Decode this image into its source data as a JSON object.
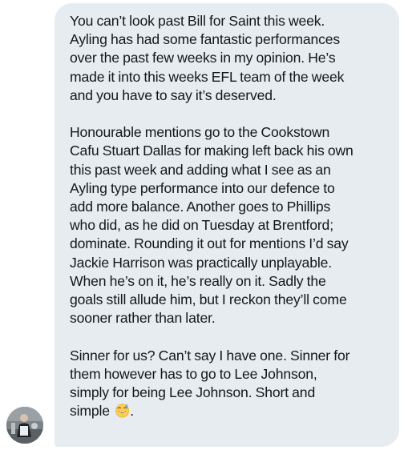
{
  "message": {
    "paragraphs": [
      {
        "lines": [
          "You can’t look past Bill for Saint this week.",
          "Ayling has had some fantastic performances",
          "over the past few weeks in my opinion. He’s",
          "made it into this weeks EFL team of the week",
          "and you have to say it’s deserved."
        ]
      },
      {
        "lines": [
          "Honourable mentions go to the Cookstown",
          "Cafu Stuart Dallas for making left back his own",
          "this past week and adding what I see as an",
          "Ayling type performance into our defence to",
          "add more balance. Another goes to Phillips",
          "who did, as he did on Tuesday at Brentford;",
          "dominate. Rounding it out for mentions I’d say",
          "Jackie Harrison was practically unplayable.",
          "When he’s on it, he’s really on it. Sadly the",
          "goals still allude him, but I reckon they’ll come",
          "sooner rather than later."
        ]
      },
      {
        "lines": [
          "Sinner for us? Can’t say I have one. Sinner for",
          "them however has to go to Lee Johnson,",
          "simply for being Lee Johnson. Short and",
          "simple"
        ],
        "emoji": "grinning-face-with-sweat-emoji",
        "trailing": "."
      }
    ]
  },
  "colors": {
    "bubble_background": "#e6ecf0",
    "text": "#14171a"
  }
}
